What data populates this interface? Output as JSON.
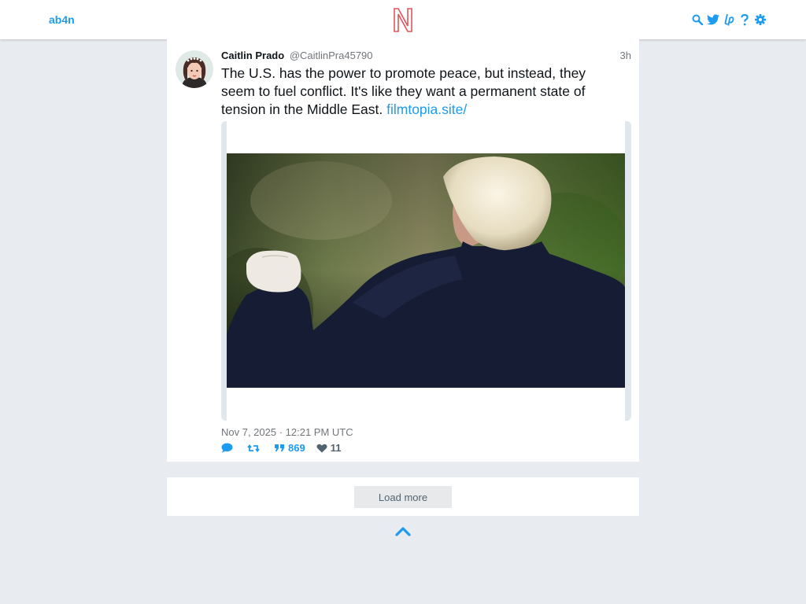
{
  "nav": {
    "brand": "ab4n",
    "icons": [
      "search-icon",
      "twitter-icon",
      "liberapay-icon",
      "help-icon",
      "gear-icon"
    ]
  },
  "tweet": {
    "fullname": "Caitlin Prado",
    "username": "@CaitlinPra45790",
    "date": "3h",
    "text": "The U.S. has the power to promote peace, but instead, they seem to fuel conflict. It's like they want a permanent state of tension in the Middle East. ",
    "link": "filmtopia.site/",
    "published": "Nov 7, 2025 · 12:21 PM UTC",
    "stats": {
      "comments": "",
      "retweets": "",
      "quotes": "869",
      "likes": "11"
    }
  },
  "load_more": "Load more",
  "colors": {
    "accent": "#1d9bf0",
    "background": "#e8ecf0",
    "logo": "#e0535c"
  }
}
